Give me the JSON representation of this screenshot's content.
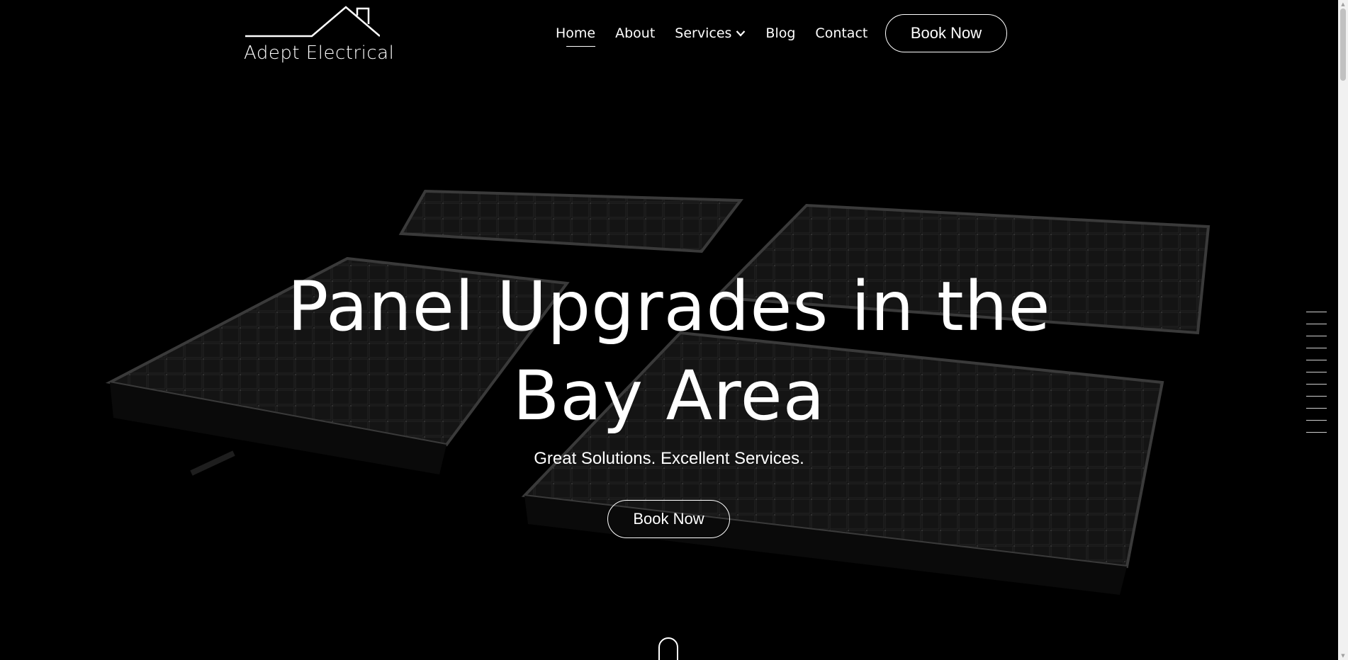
{
  "brand": {
    "name": "Adept Electrical",
    "logo_icon": "house-roof-icon"
  },
  "nav": {
    "items": [
      {
        "label": "Home",
        "active": true
      },
      {
        "label": "About",
        "active": false
      },
      {
        "label": "Services",
        "active": false,
        "has_dropdown": true
      },
      {
        "label": "Blog",
        "active": false
      },
      {
        "label": "Contact",
        "active": false
      }
    ],
    "cta_label": "Book Now"
  },
  "hero": {
    "title": "Panel Upgrades in the Bay Area",
    "subtitle": "Great Solutions. Excellent Services.",
    "cta_label": "Book Now",
    "background": "solar-panels-image"
  },
  "side_nav": {
    "count": 11
  },
  "colors": {
    "background": "#000000",
    "text": "#ffffff",
    "panel_frame": "#2a2a2a",
    "panel_cell": "#121212"
  }
}
